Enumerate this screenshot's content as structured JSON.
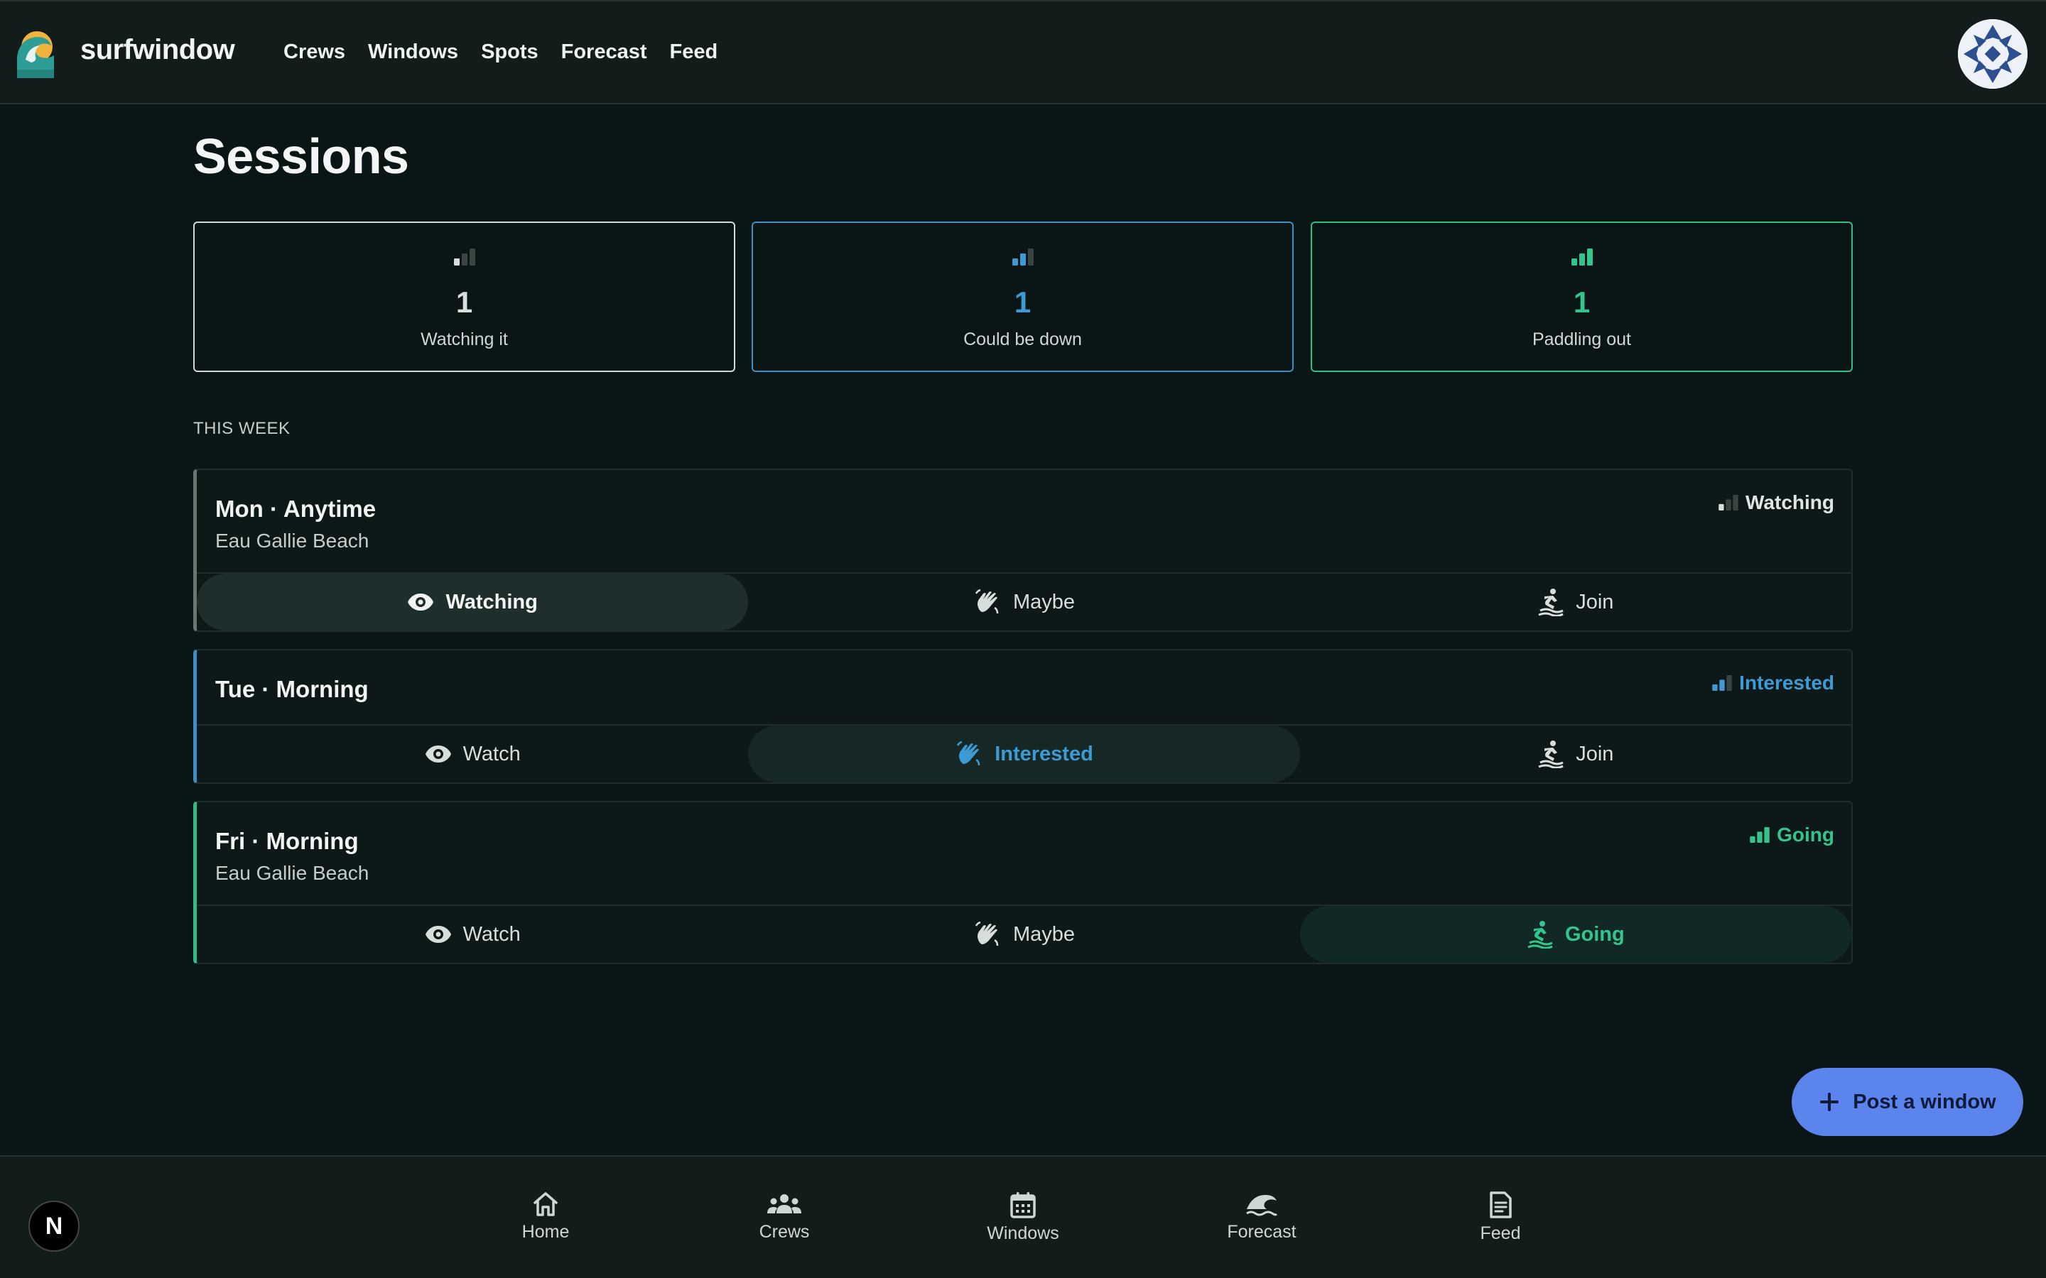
{
  "app": {
    "name": "surfwindow"
  },
  "topnav": [
    "Crews",
    "Windows",
    "Spots",
    "Forecast",
    "Feed"
  ],
  "page": {
    "title": "Sessions"
  },
  "stats": [
    {
      "count": "1",
      "label": "Watching it",
      "color": "#d9dfdd",
      "level": 1
    },
    {
      "count": "1",
      "label": "Could be down",
      "color": "#3e9ad3",
      "level": 2
    },
    {
      "count": "1",
      "label": "Paddling out",
      "color": "#33c58b",
      "level": 3
    }
  ],
  "section": {
    "label": "THIS WEEK"
  },
  "sessions": [
    {
      "title": "Mon · Anytime",
      "spot": "Eau Gallie Beach",
      "status": "Watching",
      "actions": [
        "Watching",
        "Maybe",
        "Join"
      ],
      "selected": 0
    },
    {
      "title": "Tue · Morning",
      "spot": "",
      "status": "Interested",
      "actions": [
        "Watch",
        "Interested",
        "Join"
      ],
      "selected": 1
    },
    {
      "title": "Fri · Morning",
      "spot": "Eau Gallie Beach",
      "status": "Going",
      "actions": [
        "Watch",
        "Maybe",
        "Going"
      ],
      "selected": 2
    }
  ],
  "fab": {
    "label": "Post a window"
  },
  "bottomnav": [
    "Home",
    "Crews",
    "Windows",
    "Forecast",
    "Feed"
  ],
  "badge": {
    "letter": "N"
  },
  "colors": {
    "accent": "#5b84ec",
    "watching": "#d9dfdd",
    "interested": "#3e9ad3",
    "going": "#33c58b",
    "background": "#0a1615"
  }
}
